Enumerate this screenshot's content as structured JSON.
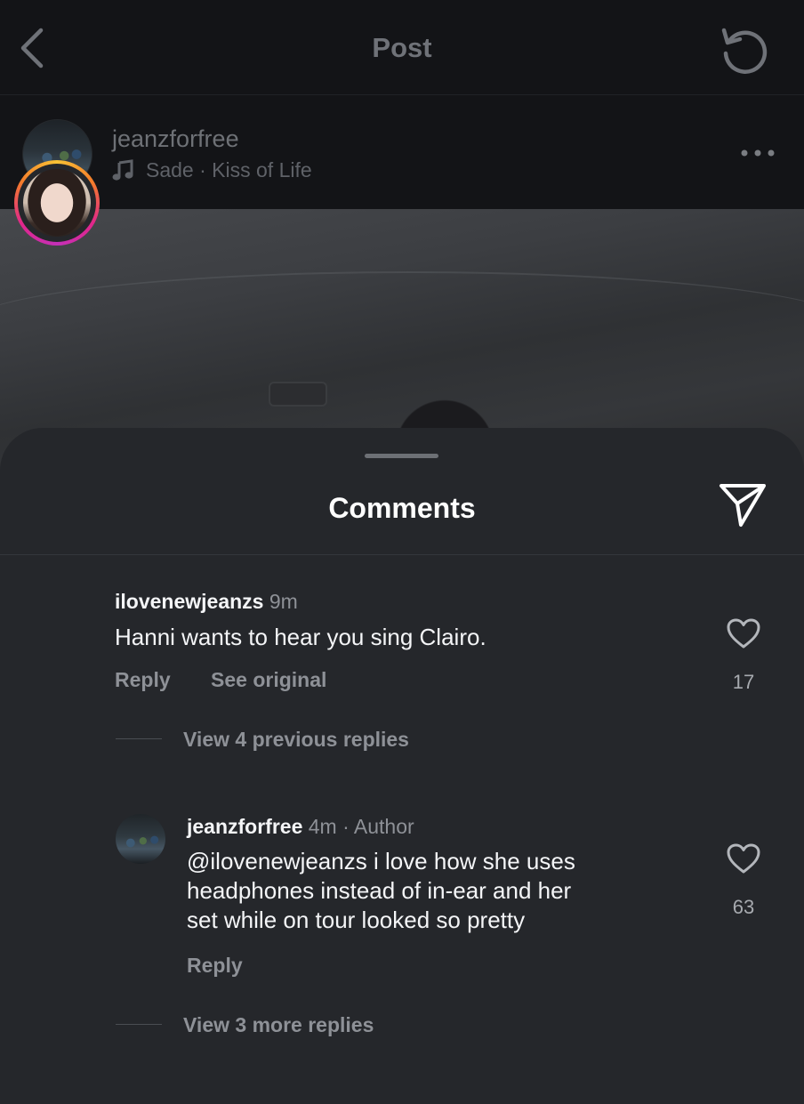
{
  "topbar": {
    "title": "Post"
  },
  "post": {
    "username": "jeanzforfree",
    "music": "Sade · Kiss of Life"
  },
  "sheet": {
    "title": "Comments"
  },
  "comments": [
    {
      "username": "ilovenewjeanzs",
      "time": "9m",
      "text": "Hanni wants to hear you sing Clairo.",
      "actions": [
        "Reply",
        "See original"
      ],
      "likes": "17"
    },
    {
      "username": "jeanzforfree",
      "time": "4m",
      "tag": "· Author",
      "text_lines": [
        "@ilovenewjeanzs i love how she uses",
        "headphones instead of in-ear and her",
        "set while on tour looked so pretty"
      ],
      "actions": [
        "Reply"
      ],
      "likes": "63"
    }
  ],
  "threads": {
    "previous": "View 4 previous replies",
    "more": "View 3 more replies"
  },
  "icons": {
    "back": "chevron-left-icon",
    "refresh": "refresh-icon",
    "music": "music-note-icon",
    "more": "more-horizontal-icon",
    "send": "send-icon",
    "like": "heart-icon"
  }
}
